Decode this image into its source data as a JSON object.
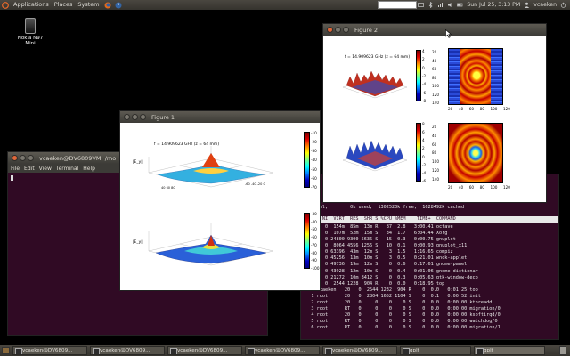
{
  "panel": {
    "menus": [
      "Applications",
      "Places",
      "System"
    ],
    "datetime": "Sun Jul 25,  3:13 PM",
    "user": "vcaeken"
  },
  "desktop": {
    "icon_label": "Nokia N97 Mini"
  },
  "term1": {
    "title": "vcaeken@DV6809VM: /mo",
    "menu": [
      "File",
      "Edit",
      "View",
      "Terminal",
      "Help"
    ]
  },
  "fig1": {
    "title": "Figure 1",
    "plot_title": "f = 14.909623 GHz (z = 64 mm)",
    "ylab_top": "|E_y|",
    "ylab_bottom": "|E_y|",
    "cbar_top": [
      "-10",
      "-20",
      "-30",
      "-40",
      "-50",
      "-60",
      "-70"
    ],
    "cbar_bottom": [
      "-30",
      "-40",
      "-50",
      "-60",
      "-70",
      "-80",
      "-90",
      "-100"
    ]
  },
  "fig2": {
    "title": "Figure 2",
    "plot_title": "f = 14.909623 GHz (z = 64 mm)",
    "cbar_top": [
      "4",
      "2",
      "0",
      "-2",
      "-4",
      "-6",
      "-8"
    ],
    "cbar_bottom": [
      "8",
      "6",
      "4",
      "2",
      "0",
      "-2",
      "-4",
      "-6"
    ],
    "map_yticks": [
      "20",
      "40",
      "60",
      "80",
      "100",
      "120",
      "140"
    ],
    "map_xticks": [
      "20",
      "40",
      "60",
      "80",
      "100",
      "120",
      "140"
    ]
  },
  "term2": {
    "mem_line": "0k total,        0k used,  1302520k free,  1628492k cached",
    "header": "   PR  NI  VIRT  RES  SHR S %CPU %MEM    TIME+  COMMAND",
    "rows": [
      "   20   0  154m  85m  13m R   87  2.8   3:00.41 octave",
      "   20   0  107m  52m  15m S   34  1.7   6:04.44 Xorg",
      "   20   0 24800 9300 5636 S   15  0.3   0:00.75 gnuplot",
      "   20   0  8064 4556 1256 S   10  0.1   0:00.93 gnuplot_x11",
      "   20   0 63396  43m  12m S    3  1.5   1:16.65 compiz",
      "   20   0 45256  13m  10m S    3  0.5   0:21.01 wnck-applet",
      "   20   0 49736  19m  12m S    0  0.6   0:17.61 gnome-panel",
      "   20   0 43928  12m  10m S    0  0.4   0:01.06 gnome-dictionar",
      "   20   0 21272  10m 8412 S    0  0.3   0:05.63 gtk-window-deco",
      "   20   0  2544 1228  904 R    0  0.0   0:18.95 top",
      "3093 vcaeken   20   0  2544 1232  904 R    0  0.0   0:01.25 top",
      "   1 root      20   0  2804 1652 1104 S    0  0.1   0:00.52 init",
      "   2 root      20   0     0    0    0 S    0  0.0   0:00.00 kthreadd",
      "   3 root      RT   0     0    0    0 S    0  0.0   0:00.00 migration/0",
      "   4 root      20   0     0    0    0 S    0  0.0   0:00.00 ksoftirqd/0",
      "   5 root      RT   0     0    0    0 S    0  0.0   0:00.00 watchdog/0",
      "   6 root      RT   0     0    0    0 S    0  0.0   0:00.00 migration/1"
    ]
  },
  "taskbar": {
    "tasks": [
      "vcaeken@DV6809...",
      "vcaeken@DV6809...",
      "vcaeken@DV6809...",
      "vcaeken@DV6809...",
      "vcaeken@DV6809...",
      "gplt",
      "gplt"
    ]
  }
}
